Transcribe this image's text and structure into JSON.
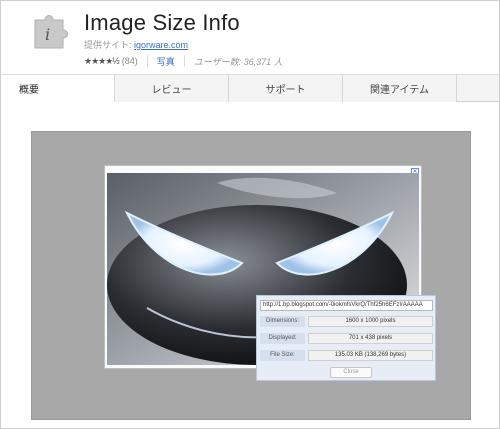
{
  "header": {
    "icon_letter": "i",
    "title": "Image Size Info",
    "provider_label": "提供サイト: ",
    "provider_link": "igorware.com",
    "stars": "★★★★½",
    "rating_count": "(84)",
    "photo_link": "写真",
    "users": "ユーザー数: 36,371 人"
  },
  "tabs": [
    {
      "label": "概要"
    },
    {
      "label": "レビュー"
    },
    {
      "label": "サポート"
    },
    {
      "label": "関連アイテム"
    }
  ],
  "screenshot": {
    "close_glyph": "✕",
    "popup": {
      "url": "http://1.bp.blogspot.com/-0iokmfsVkrQ/Thf25h6EFzI/AAAAA",
      "rows": [
        {
          "label": "Dimensions:",
          "value": "1600 x 1000 pixels"
        },
        {
          "label": "Displayed:",
          "value": "701 x 438 pixels"
        },
        {
          "label": "File Size:",
          "value": "135.03 KB (138,269 bytes)"
        }
      ],
      "close_button": "Close"
    }
  },
  "colors": {
    "link": "#3b6cc4",
    "screenshot_bg": "#a8a8a8",
    "popup_bg": "#e6edf7"
  }
}
